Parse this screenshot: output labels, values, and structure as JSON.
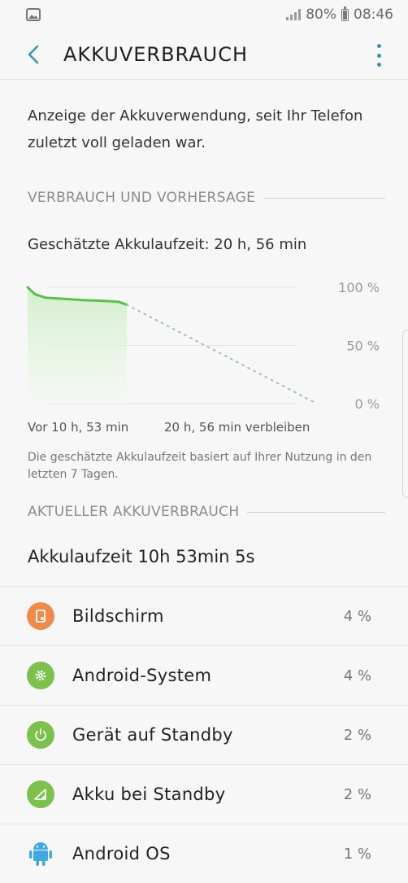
{
  "status": {
    "battery": "80%",
    "time": "08:46"
  },
  "appbar": {
    "title": "AKKUVERBRAUCH"
  },
  "intro": "Anzeige der Akkuverwendung, seit Ihr Telefon zuletzt voll geladen war.",
  "forecast": {
    "heading": "VERBRAUCH UND VORHERSAGE",
    "estimate": "Geschätzte Akkulaufzeit: 20 h, 56 min",
    "note": "Die geschätzte Akkulaufzeit basiert auf Ihrer Nutzung in den letzten 7 Tagen."
  },
  "chart_data": {
    "type": "line",
    "y_ticks": [
      "100 %",
      "50 %",
      "0 %"
    ],
    "ylim": [
      0,
      100
    ],
    "x_start_label": "Vor 10 h, 53 min",
    "x_end_label": "20 h, 56 min verbleiben",
    "series": [
      {
        "style": "solid",
        "color": "#5cbf4a",
        "x": [
          0,
          0.8,
          2,
          4,
          6,
          8,
          10,
          10.9
        ],
        "y": [
          100,
          94,
          91,
          90,
          89,
          88.5,
          87.5,
          85
        ]
      },
      {
        "style": "dotted",
        "color": "#9fc1c6",
        "x": [
          10.9,
          31.8
        ],
        "y": [
          85,
          0
        ]
      }
    ],
    "x_max": 31.8
  },
  "current": {
    "heading": "AKTUELLER AKKUVERBRAUCH",
    "screen_time": "Akkulaufzeit 10h 53min 5s"
  },
  "usage": [
    {
      "label": "Bildschirm",
      "value": "4 %",
      "icon": "screen-brightness-icon",
      "color": "#ef8a4d"
    },
    {
      "label": "Android-System",
      "value": "4 %",
      "icon": "gear-icon",
      "color": "#7dc04e"
    },
    {
      "label": "Gerät auf Standby",
      "value": "2 %",
      "icon": "power-icon",
      "color": "#7dc04e"
    },
    {
      "label": "Akku bei Standby",
      "value": "2 %",
      "icon": "cell-signal-icon",
      "color": "#7dc04e"
    },
    {
      "label": "Android OS",
      "value": "1 %",
      "icon": "android-robot-icon",
      "color": "#3fa9e0"
    }
  ]
}
